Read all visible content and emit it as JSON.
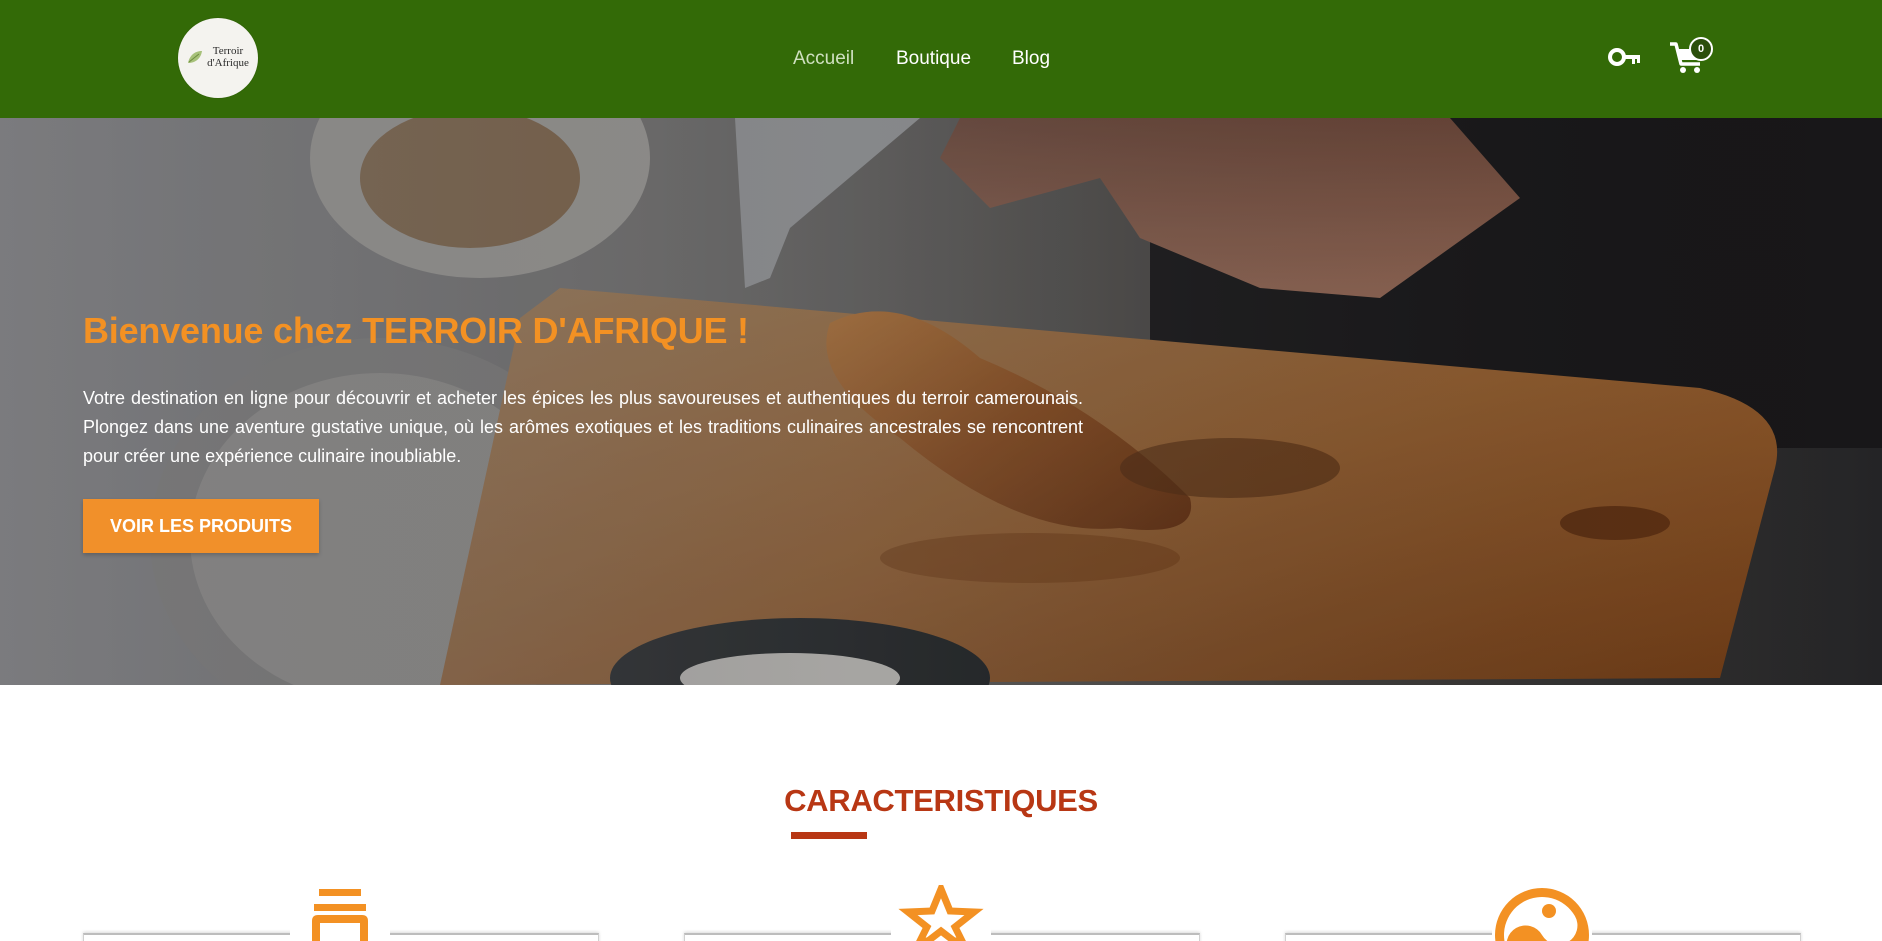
{
  "header": {
    "logo": {
      "line1": "Terroir",
      "line2": "d'Afrique"
    },
    "nav": [
      {
        "label": "Accueil",
        "active": true
      },
      {
        "label": "Boutique",
        "active": false
      },
      {
        "label": "Blog",
        "active": false
      }
    ],
    "account_icon": "key-icon",
    "cart": {
      "icon": "cart-icon",
      "count": "0"
    }
  },
  "hero": {
    "title": "Bienvenue chez TERROIR D'AFRIQUE !",
    "description": "Votre destination en ligne pour découvrir et acheter les épices les plus savoureuses et authentiques du terroir camerounais. Plongez dans une aventure gustative unique, où les arômes exotiques et les traditions culinaires ancestrales se rencontrent pour créer une expérience culinaire inoubliable.",
    "button_label": "VOIR LES PRODUITS",
    "background": "chef-slicing-chicken-on-cutting-board"
  },
  "features": {
    "title": "CARACTERISTIQUES",
    "cards": [
      {
        "icon": "jar-icon"
      },
      {
        "icon": "star-icon"
      },
      {
        "icon": "yin-yang-icon"
      }
    ]
  },
  "colors": {
    "header_bg": "#336a07",
    "accent_orange": "#f39123",
    "section_title": "#b83714"
  }
}
